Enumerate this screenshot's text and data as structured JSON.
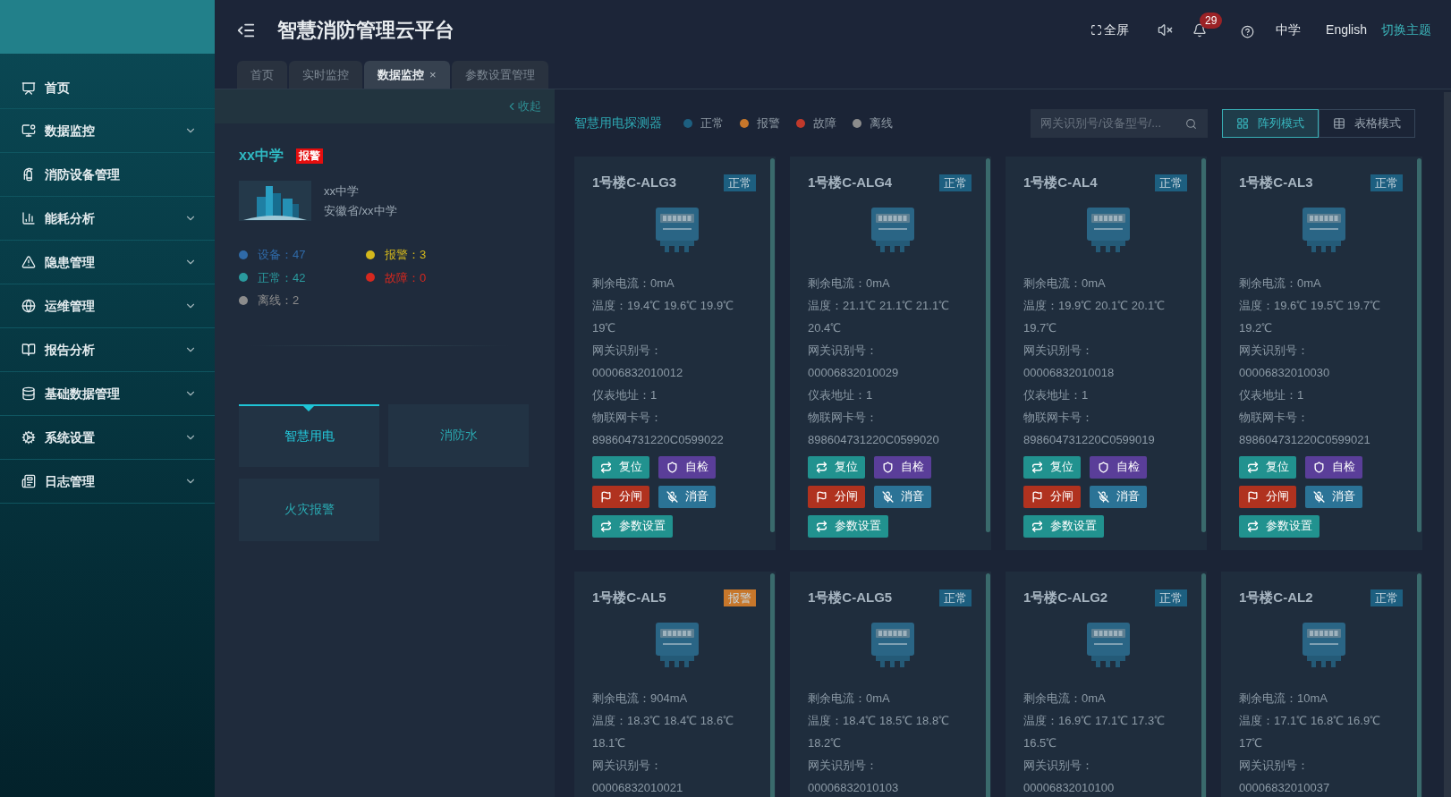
{
  "header": {
    "title": "智慧消防管理云平台",
    "fullscreen": "全屏",
    "notifications": "29",
    "school": "中学",
    "language": "English",
    "theme": "切换主题"
  },
  "sidebar": {
    "items": [
      {
        "label": "首页",
        "expandable": false
      },
      {
        "label": "数据监控",
        "expandable": true
      },
      {
        "label": "消防设备管理",
        "expandable": false
      },
      {
        "label": "能耗分析",
        "expandable": true
      },
      {
        "label": "隐患管理",
        "expandable": true
      },
      {
        "label": "运维管理",
        "expandable": true
      },
      {
        "label": "报告分析",
        "expandable": true
      },
      {
        "label": "基础数据管理",
        "expandable": true
      },
      {
        "label": "系统设置",
        "expandable": true
      },
      {
        "label": "日志管理",
        "expandable": true
      }
    ]
  },
  "tabs": [
    {
      "label": "首页",
      "selected": false
    },
    {
      "label": "实时监控",
      "selected": false
    },
    {
      "label": "数据监控",
      "selected": true,
      "close": "×"
    },
    {
      "label": "参数设置管理",
      "selected": false
    }
  ],
  "site_panel": {
    "collapse": "收起",
    "name": "xx中学",
    "badge": "报警",
    "info": [
      "xx中学",
      "安徽省/xx中学"
    ],
    "stats": [
      {
        "label": "设备：47",
        "color": "#2f6aa8"
      },
      {
        "label": "报警：3",
        "color": "#d4b81c"
      },
      {
        "label": "正常：42",
        "color": "#2a9a9e"
      },
      {
        "label": "故障：0",
        "color": "#d5281f"
      },
      {
        "label": "离线：2",
        "color": "#8c8c8c"
      }
    ],
    "systems": [
      {
        "label": "智慧用电",
        "selected": true
      },
      {
        "label": "消防水",
        "selected": false
      },
      {
        "label": "火灾报警",
        "selected": false
      }
    ]
  },
  "detector_panel": {
    "title": "智慧用电探测器",
    "legend": [
      {
        "label": "正常",
        "color": "#1d5f80"
      },
      {
        "label": "报警",
        "color": "#c7772b"
      },
      {
        "label": "故障",
        "color": "#c0392b"
      },
      {
        "label": "离线",
        "color": "#8c8c8c"
      }
    ],
    "search": {
      "placeholder": "网关识别号/设备型号/..."
    },
    "views": [
      {
        "label": "阵列模式",
        "selected": true
      },
      {
        "label": "表格模式",
        "selected": false
      }
    ],
    "cards": [
      {
        "name": "1号楼C-ALG3",
        "color": "#1d5f80",
        "status_label": "正常",
        "fields": [
          "剩余电流：0mA",
          "温度：19.4℃ 19.6℃ 19.9℃ 19℃",
          "网关识别号：",
          "00006832010012",
          "仪表地址：1",
          "物联网卡号：",
          "898604731220C0599022"
        ],
        "buttons": [
          {
            "kind": "reset",
            "label": "复位"
          },
          {
            "kind": "selftest",
            "label": "自检"
          },
          {
            "kind": "trip",
            "label": "分闸"
          },
          {
            "kind": "mute",
            "label": "消音"
          },
          {
            "kind": "params",
            "label": "参数设置"
          }
        ]
      },
      {
        "name": "1号楼C-ALG4",
        "color": "#1d5f80",
        "status_label": "正常",
        "fields": [
          "剩余电流：0mA",
          "温度：21.1℃ 21.1℃ 21.1℃ 20.4℃",
          "网关识别号：",
          "00006832010029",
          "仪表地址：1",
          "物联网卡号：",
          "898604731220C0599020"
        ],
        "buttons": [
          {
            "kind": "reset",
            "label": "复位"
          },
          {
            "kind": "selftest",
            "label": "自检"
          },
          {
            "kind": "trip",
            "label": "分闸"
          },
          {
            "kind": "mute",
            "label": "消音"
          },
          {
            "kind": "params",
            "label": "参数设置"
          }
        ]
      },
      {
        "name": "1号楼C-AL4",
        "color": "#1d5f80",
        "status_label": "正常",
        "fields": [
          "剩余电流：0mA",
          "温度：19.9℃ 20.1℃ 20.1℃ 19.7℃",
          "网关识别号：",
          "00006832010018",
          "仪表地址：1",
          "物联网卡号：",
          "898604731220C0599019"
        ],
        "buttons": [
          {
            "kind": "reset",
            "label": "复位"
          },
          {
            "kind": "selftest",
            "label": "自检"
          },
          {
            "kind": "trip",
            "label": "分闸"
          },
          {
            "kind": "mute",
            "label": "消音"
          },
          {
            "kind": "params",
            "label": "参数设置"
          }
        ]
      },
      {
        "name": "1号楼C-AL3",
        "color": "#1d5f80",
        "status_label": "正常",
        "fields": [
          "剩余电流：0mA",
          "温度：19.6℃ 19.5℃ 19.7℃ 19.2℃",
          "网关识别号：",
          "00006832010030",
          "仪表地址：1",
          "物联网卡号：",
          "898604731220C0599021"
        ],
        "buttons": [
          {
            "kind": "reset",
            "label": "复位"
          },
          {
            "kind": "selftest",
            "label": "自检"
          },
          {
            "kind": "trip",
            "label": "分闸"
          },
          {
            "kind": "mute",
            "label": "消音"
          },
          {
            "kind": "params",
            "label": "参数设置"
          }
        ]
      },
      {
        "name": "1号楼C-AL5",
        "color": "#c7772b",
        "status_label": "报警",
        "fields": [
          "剩余电流：904mA",
          "温度：18.3℃ 18.4℃ 18.6℃ 18.1℃",
          "网关识别号：",
          "00006832010021"
        ]
      },
      {
        "name": "1号楼C-ALG5",
        "color": "#1d5f80",
        "status_label": "正常",
        "fields": [
          "剩余电流：0mA",
          "温度：18.4℃ 18.5℃ 18.8℃ 18.2℃",
          "网关识别号：",
          "00006832010103"
        ]
      },
      {
        "name": "1号楼C-ALG2",
        "color": "#1d5f80",
        "status_label": "正常",
        "fields": [
          "剩余电流：0mA",
          "温度：16.9℃ 17.1℃ 17.3℃ 16.5℃",
          "网关识别号：",
          "00006832010100"
        ]
      },
      {
        "name": "1号楼C-AL2",
        "color": "#1d5f80",
        "status_label": "正常",
        "fields": [
          "剩余电流：10mA",
          "温度：17.1℃ 16.8℃ 16.9℃ 17℃",
          "网关识别号：",
          "00006832010037"
        ]
      }
    ]
  }
}
